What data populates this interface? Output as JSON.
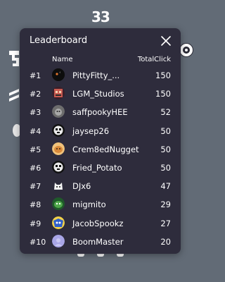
{
  "background": {
    "score_text": "33"
  },
  "leaderboard": {
    "title": "Leaderboard",
    "columns": {
      "name": "Name",
      "total": "TotalClick"
    },
    "rows": [
      {
        "rank": "#1",
        "name": "PittyFitty_...",
        "score": "150",
        "avatar": "dark-cat-avatar",
        "color": "#111111"
      },
      {
        "rank": "#2",
        "name": "LGM_Studios",
        "score": "150",
        "avatar": "pixel-face-avatar",
        "color": "#c85a50"
      },
      {
        "rank": "#3",
        "name": "saffpookyHEE",
        "score": "52",
        "avatar": "gray-blob-avatar",
        "color": "#8a8a8a"
      },
      {
        "rank": "#4",
        "name": "jaysep26",
        "score": "50",
        "avatar": "qr-cat-avatar",
        "color": "#dddddd"
      },
      {
        "rank": "#5",
        "name": "Crem8edNugget",
        "score": "50",
        "avatar": "nugget-avatar",
        "color": "#e09a4a"
      },
      {
        "rank": "#6",
        "name": "Fried_Potato",
        "score": "50",
        "avatar": "qr-cat-avatar",
        "color": "#dddddd"
      },
      {
        "rank": "#7",
        "name": "DJx6",
        "score": "47",
        "avatar": "ghost-cat-avatar",
        "color": "#f2f2f2"
      },
      {
        "rank": "#8",
        "name": "migmito",
        "score": "29",
        "avatar": "green-creature-avatar",
        "color": "#3b8a3a"
      },
      {
        "rank": "#9",
        "name": "JacobSpookz",
        "score": "27",
        "avatar": "blue-sonic-avatar",
        "color": "#2f5fc9"
      },
      {
        "rank": "#10",
        "name": "BoomMaster",
        "score": "20",
        "avatar": "lavender-avatar",
        "color": "#a9a6e6"
      }
    ]
  }
}
